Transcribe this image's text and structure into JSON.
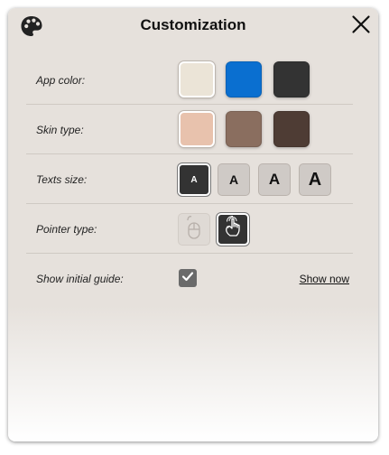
{
  "dialog": {
    "title": "Customization",
    "header_icon": "palette-icon",
    "close_icon": "close-icon"
  },
  "rows": {
    "app_color": {
      "label": "App color:",
      "options": [
        {
          "name": "cream",
          "color": "#ebe4d7",
          "selected": true
        },
        {
          "name": "blue",
          "color": "#0a6fd0",
          "selected": false
        },
        {
          "name": "dark",
          "color": "#333333",
          "selected": false
        }
      ]
    },
    "skin_type": {
      "label": "Skin type:",
      "options": [
        {
          "name": "light",
          "color": "#e8c2ad",
          "selected": true
        },
        {
          "name": "medium",
          "color": "#8a6e5f",
          "selected": false
        },
        {
          "name": "dark",
          "color": "#4e3c34",
          "selected": false
        }
      ]
    },
    "texts_size": {
      "label": "Texts size:",
      "options": [
        {
          "label": "A",
          "selected": true
        },
        {
          "label": "A",
          "selected": false
        },
        {
          "label": "A",
          "selected": false
        },
        {
          "label": "A",
          "selected": false
        }
      ]
    },
    "pointer_type": {
      "label": "Pointer type:",
      "options": [
        {
          "icon": "mouse-icon",
          "selected": false
        },
        {
          "icon": "touch-hand-icon",
          "selected": true
        }
      ]
    },
    "initial_guide": {
      "label": "Show initial guide:",
      "checked": true,
      "link_label": "Show now"
    }
  },
  "colors": {
    "panel_bg": "#e6e1dc",
    "selected_dark": "#333333",
    "checkbox": "#6a6a6a"
  }
}
